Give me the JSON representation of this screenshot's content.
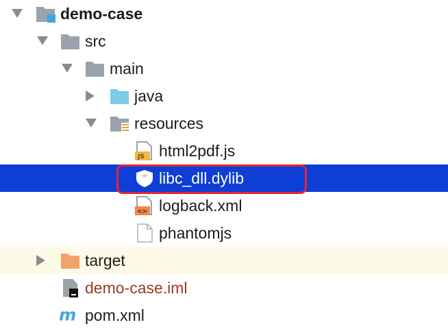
{
  "tree": {
    "items": [
      {
        "label": "demo-case",
        "icon": "module-folder-icon",
        "expanded": true
      },
      {
        "label": "src",
        "icon": "folder-icon",
        "expanded": true
      },
      {
        "label": "main",
        "icon": "folder-icon",
        "expanded": true
      },
      {
        "label": "java",
        "icon": "source-folder-icon",
        "expanded": false
      },
      {
        "label": "resources",
        "icon": "resources-folder-icon",
        "expanded": true
      },
      {
        "label": "html2pdf.js",
        "icon": "js-file-icon"
      },
      {
        "label": "libc_dll.dylib",
        "icon": "dylib-file-icon",
        "selected": true
      },
      {
        "label": "logback.xml",
        "icon": "xml-file-icon"
      },
      {
        "label": "phantomjs",
        "icon": "file-icon"
      },
      {
        "label": "target",
        "icon": "excluded-folder-icon",
        "expanded": false
      },
      {
        "label": "demo-case.iml",
        "icon": "iml-file-icon"
      },
      {
        "label": "pom.xml",
        "icon": "maven-icon"
      }
    ]
  },
  "colors": {
    "selection": "#0d3fd6",
    "selection_outline": "#e8232f",
    "target_row": "#fdfbe7",
    "iml_text": "#9b3a1d"
  }
}
